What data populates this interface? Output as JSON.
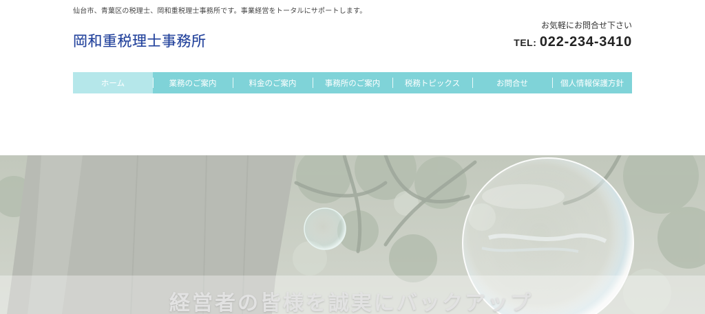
{
  "header": {
    "tagline": "仙台市、青葉区の税理士、岡和重税理士事務所です。事業経営をトータルにサポートします。",
    "logo": "岡和重税理士事務所",
    "contact_note": "お気軽にお問合せ下さい",
    "tel_prefix": "TEL:",
    "tel_number": "022-234-3410"
  },
  "nav": {
    "items": [
      {
        "label": "ホーム",
        "active": true
      },
      {
        "label": "業務のご案内",
        "active": false
      },
      {
        "label": "料金のご案内",
        "active": false
      },
      {
        "label": "事務所のご案内",
        "active": false
      },
      {
        "label": "税務トピックス",
        "active": false
      },
      {
        "label": "お問合せ",
        "active": false
      },
      {
        "label": "個人情報保護方針",
        "active": false
      }
    ]
  },
  "hero": {
    "caption": "経営者の皆様を誠実にバックアップ"
  },
  "colors": {
    "brand": "#1f3f9a",
    "nav_background": "#7fd3d8",
    "nav_active": "#b5e7ea"
  }
}
